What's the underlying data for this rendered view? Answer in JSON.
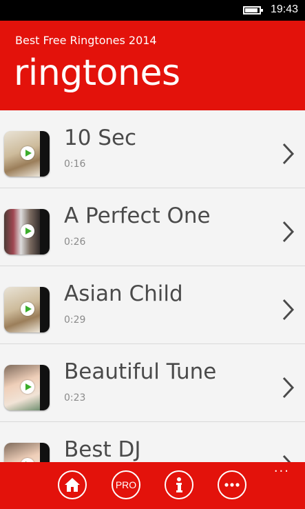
{
  "status_bar": {
    "time": "19:43"
  },
  "header": {
    "app_name": "Best Free Ringtones 2014",
    "page_title": "ringtones"
  },
  "ringtones": [
    {
      "title": "10 Sec",
      "duration": "0:16",
      "thumbnail": "video-thumbnail"
    },
    {
      "title": "A Perfect One",
      "duration": "0:26",
      "thumbnail": "video-thumbnail"
    },
    {
      "title": "Asian Child",
      "duration": "0:29",
      "thumbnail": "video-thumbnail"
    },
    {
      "title": "Beautiful Tune",
      "duration": "0:23",
      "thumbnail": "video-thumbnail"
    },
    {
      "title": "Best DJ",
      "duration": "",
      "thumbnail": "video-thumbnail"
    }
  ],
  "app_bar": {
    "buttons": [
      {
        "name": "home",
        "icon": "home-icon"
      },
      {
        "name": "pro",
        "label": "PRO"
      },
      {
        "name": "info",
        "icon": "info-icon"
      },
      {
        "name": "more",
        "icon": "ellipsis-icon"
      }
    ],
    "overflow": "..."
  },
  "colors": {
    "accent": "#e3120b",
    "background": "#f4f4f4",
    "title_text": "#4a4a4a",
    "secondary_text": "#8a8a8a",
    "status_bar": "#000000"
  }
}
